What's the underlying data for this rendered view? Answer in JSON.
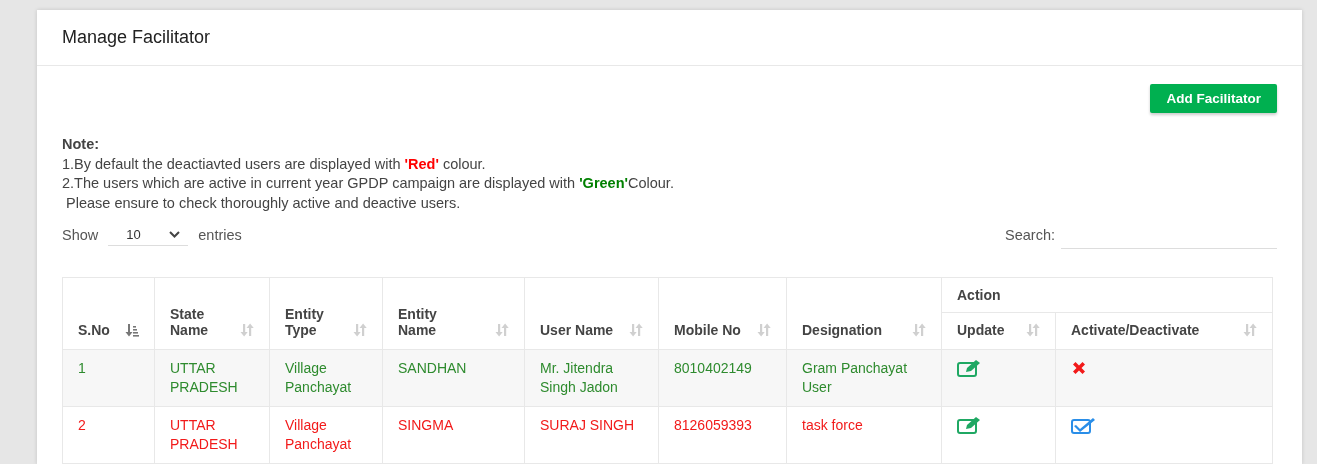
{
  "panel": {
    "title": "Manage Facilitator"
  },
  "add_button": {
    "label": "Add Facilitator"
  },
  "note": {
    "heading": "Note:",
    "lines": [
      {
        "text": "1.By default the deactiavted users are displayed with **'Red'** colour.",
        "color": "#ff0000"
      },
      {
        "text": "2.The users which are active in current year GPDP campaign are displayed with **'Green'**Colour.",
        "color": "#008000"
      },
      {
        "text": " Please ensure to check thoroughly active and deactive users."
      }
    ]
  },
  "length_control": {
    "before": "Show",
    "value": "10",
    "after": "entries"
  },
  "search": {
    "label": "Search:"
  },
  "table": {
    "group_header": "Action",
    "columns": [
      {
        "label": "S.No",
        "sorted": true
      },
      {
        "label": "State Name",
        "sorted": false
      },
      {
        "label": "Entity Type",
        "sorted": false
      },
      {
        "label": "Entity Name",
        "sorted": false
      },
      {
        "label": "User Name",
        "sorted": false
      },
      {
        "label": "Mobile No",
        "sorted": false
      },
      {
        "label": "Designation",
        "sorted": false
      },
      {
        "label": "Update",
        "sorted": false
      },
      {
        "label": "Activate/Deactivate",
        "sorted": false
      }
    ],
    "rows": [
      {
        "active": true,
        "cells": [
          "1",
          "UTTAR PRADESH",
          "Village Panchayat",
          "SANDHAN",
          "Mr. Jitendra Singh Jadon",
          "8010402149",
          "Gram Panchayat User"
        ]
      },
      {
        "active": false,
        "cells": [
          "2",
          "UTTAR PRADESH",
          "Village Panchayat",
          "SINGMA",
          "SURAJ SINGH",
          "8126059393",
          "task force"
        ]
      }
    ]
  }
}
